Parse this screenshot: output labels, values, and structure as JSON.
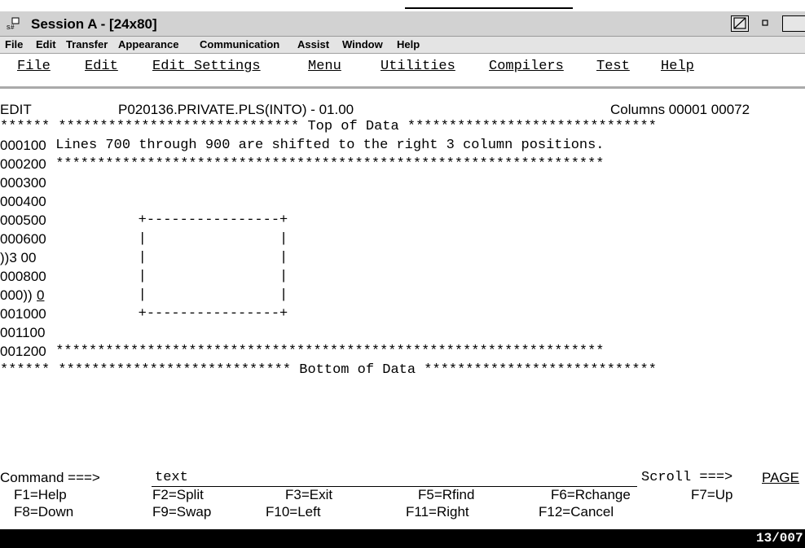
{
  "window": {
    "title": "Session A - [24x80]"
  },
  "emulator_menu": [
    "File",
    "Edit",
    "Transfer",
    "Appearance",
    "Communication",
    "Assist",
    "Window",
    "Help"
  ],
  "ispf_menu": [
    "File",
    "Edit",
    "Edit_Settings",
    "Menu",
    "Utilities",
    "Compilers",
    "Test",
    "Help"
  ],
  "header": {
    "mode": "EDIT",
    "dataset": "P020136.PRIVATE.PLS(INTO) - 01.00",
    "columns": "Columns 00001 00072"
  },
  "lines": {
    "top": "****** ***************************** Top of Data ******************************",
    "l1_no": "000100",
    "l1_text": " Lines 700 through 900 are shifted to the right 3 column positions.",
    "l2_no": "000200",
    "l2_text": " ******************************************************************",
    "l3_no": "000300",
    "l4_no": "000400",
    "l5_no": "000500",
    "l5_text": "        +----------------+",
    "l6_no": "000600",
    "l6_text": "        |                |",
    "l7_no": "))3 00",
    "l7_text": "        |                |",
    "l8_no": "000800",
    "l8_text": "        |                |",
    "l9_no": "000))",
    "l9_tail": "0",
    "l9_text": "        |                |",
    "l10_no": "001000",
    "l10_text": "        +----------------+",
    "l11_no": "001100",
    "l12_no": "001200",
    "l12_text": " ******************************************************************",
    "bottom": "****** **************************** Bottom of Data ****************************"
  },
  "command": {
    "label": "Command ===>",
    "value": "text",
    "scroll_label": "Scroll ===>",
    "scroll_value": "PAGE"
  },
  "fkeys_row1": [
    "F1=Help",
    "F2=Split",
    "F3=Exit",
    "F5=Rfind",
    "F6=Rchange",
    "F7=Up"
  ],
  "fkeys_row2": [
    "F8=Down",
    "F9=Swap",
    "F10=Left",
    "F11=Right",
    "F12=Cancel"
  ],
  "status": {
    "cursor": "13/007"
  }
}
